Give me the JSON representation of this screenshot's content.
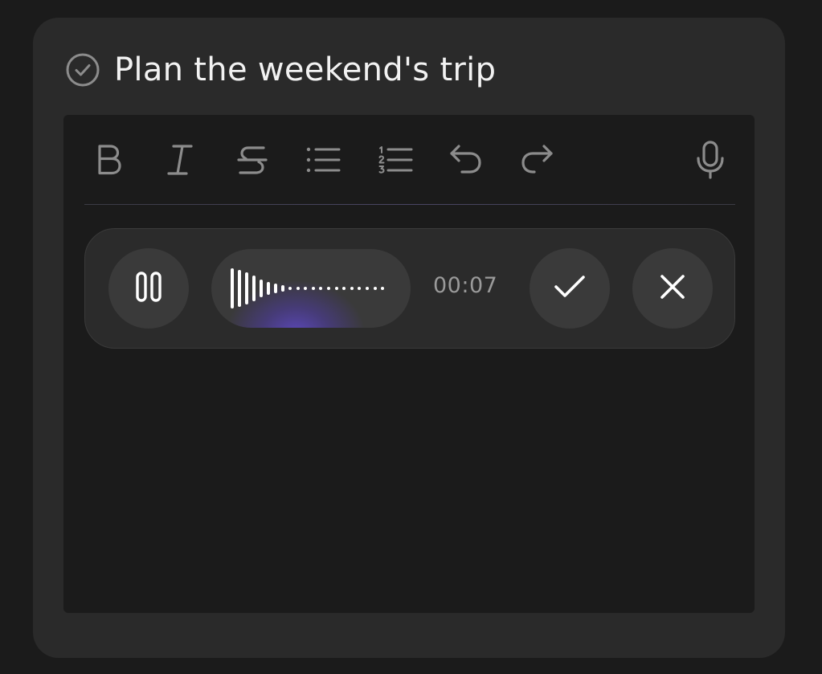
{
  "task": {
    "title": "Plan the weekend's trip",
    "status_icon": "check-circle-icon"
  },
  "toolbar": {
    "buttons": [
      {
        "name": "bold",
        "icon": "bold-icon"
      },
      {
        "name": "italic",
        "icon": "italic-icon"
      },
      {
        "name": "strikethrough",
        "icon": "strikethrough-icon"
      },
      {
        "name": "bullet-list",
        "icon": "bullet-list-icon"
      },
      {
        "name": "numbered-list",
        "icon": "numbered-list-icon"
      },
      {
        "name": "undo",
        "icon": "undo-icon"
      },
      {
        "name": "redo",
        "icon": "redo-icon"
      },
      {
        "name": "microphone",
        "icon": "microphone-icon"
      }
    ]
  },
  "recorder": {
    "pause_icon": "pause-icon",
    "waveform_icon": "waveform-icon",
    "elapsed": "00:07",
    "confirm_icon": "check-icon",
    "cancel_icon": "close-icon"
  },
  "colors": {
    "page_background": "#1b1b1b",
    "card_background": "#2a2a2a",
    "editor_background": "#1b1b1b",
    "button_background": "#3a3a3a",
    "icon_color": "#8c8c8c",
    "accent_glow": "#5c48be",
    "text_primary": "#f2f2f2",
    "text_secondary": "#9a9a9a"
  }
}
